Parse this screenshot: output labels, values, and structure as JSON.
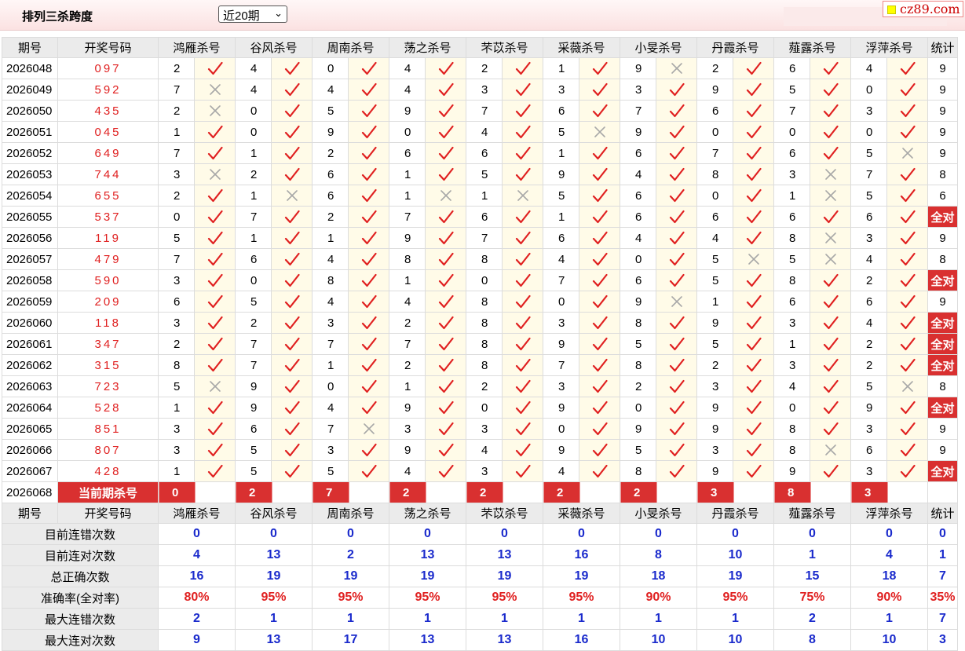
{
  "header": {
    "title": "排列三杀跨度",
    "range_select": "近20期",
    "logo_text": "cz89.com"
  },
  "columns": [
    "期号",
    "开奖号码",
    "鸿雁杀号",
    "谷风杀号",
    "周南杀号",
    "荡之杀号",
    "芣苡杀号",
    "采薇杀号",
    "小旻杀号",
    "丹霞杀号",
    "薤露杀号",
    "浮萍杀号",
    "统计"
  ],
  "rows": [
    {
      "period": "2026048",
      "draw": "097",
      "kills": [
        2,
        4,
        0,
        4,
        2,
        1,
        9,
        2,
        6,
        4
      ],
      "hits": [
        1,
        1,
        1,
        1,
        1,
        1,
        0,
        1,
        1,
        1
      ],
      "stat": "9"
    },
    {
      "period": "2026049",
      "draw": "592",
      "kills": [
        7,
        4,
        4,
        4,
        3,
        3,
        3,
        9,
        5,
        0
      ],
      "hits": [
        0,
        1,
        1,
        1,
        1,
        1,
        1,
        1,
        1,
        1
      ],
      "stat": "9"
    },
    {
      "period": "2026050",
      "draw": "435",
      "kills": [
        2,
        0,
        5,
        9,
        7,
        6,
        7,
        6,
        7,
        3
      ],
      "hits": [
        0,
        1,
        1,
        1,
        1,
        1,
        1,
        1,
        1,
        1
      ],
      "stat": "9"
    },
    {
      "period": "2026051",
      "draw": "045",
      "kills": [
        1,
        0,
        9,
        0,
        4,
        5,
        9,
        0,
        0,
        0
      ],
      "hits": [
        1,
        1,
        1,
        1,
        1,
        0,
        1,
        1,
        1,
        1
      ],
      "stat": "9"
    },
    {
      "period": "2026052",
      "draw": "649",
      "kills": [
        7,
        1,
        2,
        6,
        6,
        1,
        6,
        7,
        6,
        5
      ],
      "hits": [
        1,
        1,
        1,
        1,
        1,
        1,
        1,
        1,
        1,
        0
      ],
      "stat": "9"
    },
    {
      "period": "2026053",
      "draw": "744",
      "kills": [
        3,
        2,
        6,
        1,
        5,
        9,
        4,
        8,
        3,
        7
      ],
      "hits": [
        0,
        1,
        1,
        1,
        1,
        1,
        1,
        1,
        0,
        1
      ],
      "stat": "8"
    },
    {
      "period": "2026054",
      "draw": "655",
      "kills": [
        2,
        1,
        6,
        1,
        1,
        5,
        6,
        0,
        1,
        5
      ],
      "hits": [
        1,
        0,
        1,
        0,
        0,
        1,
        1,
        1,
        0,
        1
      ],
      "stat": "6"
    },
    {
      "period": "2026055",
      "draw": "537",
      "kills": [
        0,
        7,
        2,
        7,
        6,
        1,
        6,
        6,
        6,
        6
      ],
      "hits": [
        1,
        1,
        1,
        1,
        1,
        1,
        1,
        1,
        1,
        1
      ],
      "stat": "全对"
    },
    {
      "period": "2026056",
      "draw": "119",
      "kills": [
        5,
        1,
        1,
        9,
        7,
        6,
        4,
        4,
        8,
        3
      ],
      "hits": [
        1,
        1,
        1,
        1,
        1,
        1,
        1,
        1,
        0,
        1
      ],
      "stat": "9"
    },
    {
      "period": "2026057",
      "draw": "479",
      "kills": [
        7,
        6,
        4,
        8,
        8,
        4,
        0,
        5,
        5,
        4
      ],
      "hits": [
        1,
        1,
        1,
        1,
        1,
        1,
        1,
        0,
        0,
        1
      ],
      "stat": "8"
    },
    {
      "period": "2026058",
      "draw": "590",
      "kills": [
        3,
        0,
        8,
        1,
        0,
        7,
        6,
        5,
        8,
        2
      ],
      "hits": [
        1,
        1,
        1,
        1,
        1,
        1,
        1,
        1,
        1,
        1
      ],
      "stat": "全对"
    },
    {
      "period": "2026059",
      "draw": "209",
      "kills": [
        6,
        5,
        4,
        4,
        8,
        0,
        9,
        1,
        6,
        6
      ],
      "hits": [
        1,
        1,
        1,
        1,
        1,
        1,
        0,
        1,
        1,
        1
      ],
      "stat": "9"
    },
    {
      "period": "2026060",
      "draw": "118",
      "kills": [
        3,
        2,
        3,
        2,
        8,
        3,
        8,
        9,
        3,
        4
      ],
      "hits": [
        1,
        1,
        1,
        1,
        1,
        1,
        1,
        1,
        1,
        1
      ],
      "stat": "全对"
    },
    {
      "period": "2026061",
      "draw": "347",
      "kills": [
        2,
        7,
        7,
        7,
        8,
        9,
        5,
        5,
        1,
        2
      ],
      "hits": [
        1,
        1,
        1,
        1,
        1,
        1,
        1,
        1,
        1,
        1
      ],
      "stat": "全对"
    },
    {
      "period": "2026062",
      "draw": "315",
      "kills": [
        8,
        7,
        1,
        2,
        8,
        7,
        8,
        2,
        3,
        2
      ],
      "hits": [
        1,
        1,
        1,
        1,
        1,
        1,
        1,
        1,
        1,
        1
      ],
      "stat": "全对"
    },
    {
      "period": "2026063",
      "draw": "723",
      "kills": [
        5,
        9,
        0,
        1,
        2,
        3,
        2,
        3,
        4,
        5
      ],
      "hits": [
        0,
        1,
        1,
        1,
        1,
        1,
        1,
        1,
        1,
        0
      ],
      "stat": "8"
    },
    {
      "period": "2026064",
      "draw": "528",
      "kills": [
        1,
        9,
        4,
        9,
        0,
        9,
        0,
        9,
        0,
        9
      ],
      "hits": [
        1,
        1,
        1,
        1,
        1,
        1,
        1,
        1,
        1,
        1
      ],
      "stat": "全对"
    },
    {
      "period": "2026065",
      "draw": "851",
      "kills": [
        3,
        6,
        7,
        3,
        3,
        0,
        9,
        9,
        8,
        3
      ],
      "hits": [
        1,
        1,
        0,
        1,
        1,
        1,
        1,
        1,
        1,
        1
      ],
      "stat": "9"
    },
    {
      "period": "2026066",
      "draw": "807",
      "kills": [
        3,
        5,
        3,
        9,
        4,
        9,
        5,
        3,
        8,
        6
      ],
      "hits": [
        1,
        1,
        1,
        1,
        1,
        1,
        1,
        1,
        0,
        1
      ],
      "stat": "9"
    },
    {
      "period": "2026067",
      "draw": "428",
      "kills": [
        1,
        5,
        5,
        4,
        3,
        4,
        8,
        9,
        9,
        3
      ],
      "hits": [
        1,
        1,
        1,
        1,
        1,
        1,
        1,
        1,
        1,
        1
      ],
      "stat": "全对"
    }
  ],
  "current": {
    "period": "2026068",
    "label": "当前期杀号",
    "kills": [
      "0",
      "2",
      "7",
      "2",
      "2",
      "2",
      "2",
      "3",
      "8",
      "3"
    ]
  },
  "summary_rows": [
    {
      "label": "目前连错次数",
      "values": [
        "0",
        "0",
        "0",
        "0",
        "0",
        "0",
        "0",
        "0",
        "0",
        "0",
        "0"
      ],
      "color": "blue"
    },
    {
      "label": "目前连对次数",
      "values": [
        "4",
        "13",
        "2",
        "13",
        "13",
        "16",
        "8",
        "10",
        "1",
        "4",
        "1"
      ],
      "color": "blue"
    },
    {
      "label": "总正确次数",
      "values": [
        "16",
        "19",
        "19",
        "19",
        "19",
        "19",
        "18",
        "19",
        "15",
        "18",
        "7"
      ],
      "color": "blue"
    },
    {
      "label": "准确率(全对率)",
      "values": [
        "80%",
        "95%",
        "95%",
        "95%",
        "95%",
        "95%",
        "90%",
        "95%",
        "75%",
        "90%",
        "35%"
      ],
      "color": "red"
    },
    {
      "label": "最大连错次数",
      "values": [
        "2",
        "1",
        "1",
        "1",
        "1",
        "1",
        "1",
        "1",
        "2",
        "1",
        "7"
      ],
      "color": "blue"
    },
    {
      "label": "最大连对次数",
      "values": [
        "9",
        "13",
        "17",
        "13",
        "13",
        "16",
        "10",
        "10",
        "8",
        "10",
        "3"
      ],
      "color": "blue"
    }
  ],
  "colors": {
    "accent_red": "#d93030",
    "check_red": "#e02020",
    "value_blue": "#1a2acc",
    "header_gray": "#ebebeb",
    "mark_bg": "#fffbe8"
  }
}
